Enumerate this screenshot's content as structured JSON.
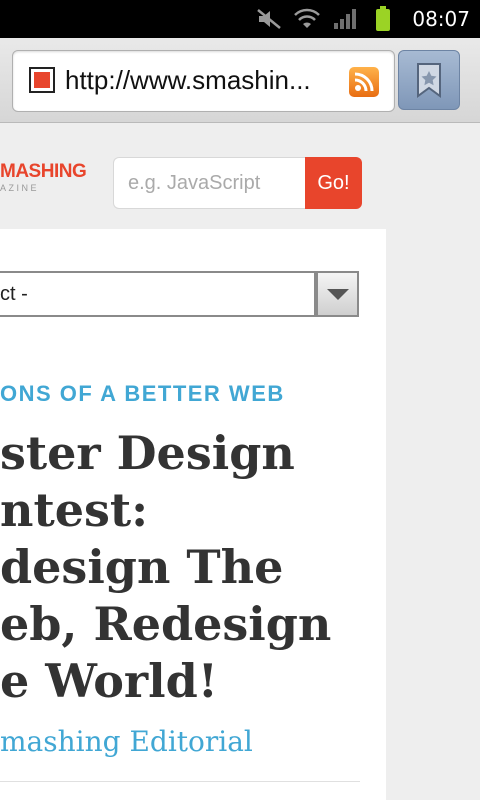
{
  "status_bar": {
    "time": "08:07",
    "icons": [
      "mute-icon",
      "wifi-icon",
      "signal-icon",
      "battery-icon"
    ]
  },
  "browser": {
    "url": "http://www.smashin...",
    "icons": [
      "favicon-icon",
      "rss-icon",
      "bookmark-icon"
    ]
  },
  "site": {
    "logo_line1": "MASHING",
    "logo_line2": "AZINE",
    "search_placeholder": "e.g. JavaScript",
    "search_value": "",
    "go_label": "Go!",
    "select_value": "ct -",
    "category": "ONS OF A BETTER WEB",
    "title_lines": [
      "ster Design",
      "ntest:",
      "design The",
      "eb, Redesign",
      "e World!"
    ],
    "author": "mashing Editorial"
  },
  "colors": {
    "accent": "#e8452c",
    "link": "#41a7d4",
    "text": "#333333"
  }
}
